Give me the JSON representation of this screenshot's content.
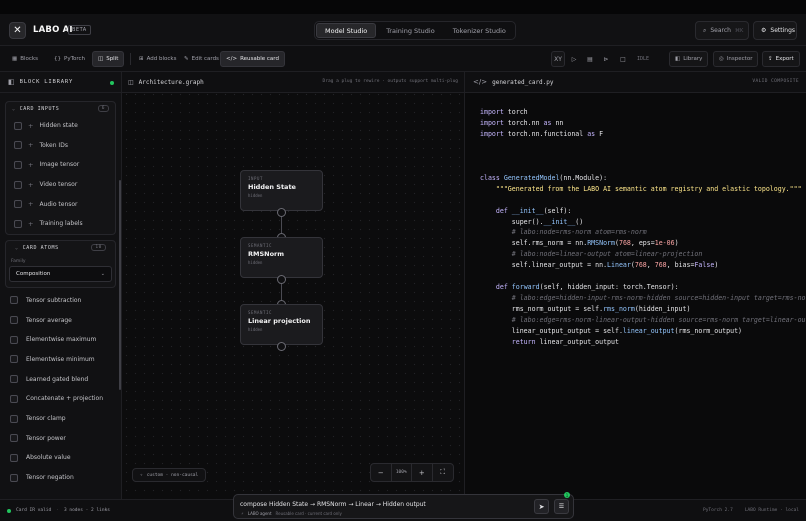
{
  "app": {
    "brand": "LABO AI",
    "badge": "BETA",
    "studio_tabs": [
      {
        "label": "Model Studio",
        "active": true
      },
      {
        "label": "Training Studio",
        "active": false
      },
      {
        "label": "Tokenizer Studio",
        "active": false
      }
    ],
    "search_label": "Search",
    "search_shortcut": "⌘K",
    "settings_label": "Settings"
  },
  "toolbar": {
    "blocks": "Blocks",
    "pytorch": "PyTorch",
    "split": "Split",
    "add_blocks": "Add blocks",
    "edit_cards": "Edit cards",
    "reusable_card": "Reusable card",
    "xy": "XY",
    "idle": "IDLE",
    "library": "Library",
    "inspector": "Inspector",
    "export": "Export"
  },
  "block_library": {
    "title": "BLOCK LIBRARY",
    "card_inputs": {
      "title": "CARD INPUTS",
      "count": "6",
      "items": [
        "Hidden state",
        "Token IDs",
        "Image tensor",
        "Video tensor",
        "Audio tensor",
        "Training labels"
      ]
    },
    "card_atoms": {
      "title": "CARD ATOMS",
      "count": "10",
      "family_label": "Family",
      "family_value": "Composition",
      "items": [
        "Tensor subtraction",
        "Tensor average",
        "Elementwise maximum",
        "Elementwise minimum",
        "Learned gated blend",
        "Concatenate + projection",
        "Tensor clamp",
        "Tensor power",
        "Absolute value",
        "Tensor negation"
      ]
    }
  },
  "graph": {
    "title": "Architecture.graph",
    "hint": "Drag a plug to rewire · outputs support multi-plug",
    "nodes": [
      {
        "kind": "INPUT",
        "title": "Hidden State",
        "sub": "hidden"
      },
      {
        "kind": "SEMANTIC",
        "title": "RMSNorm",
        "sub": "hidden"
      },
      {
        "kind": "SEMANTIC",
        "title": "Linear projection",
        "sub": "hidden"
      }
    ],
    "mode": "custom · non-causal",
    "zoom": "100%",
    "zoom_minus": "−",
    "zoom_plus": "+",
    "fit": "⛶"
  },
  "code": {
    "filename": "generated_card.py",
    "status": "VALID COMPOSITE"
  },
  "status": {
    "ir": "Card IR valid",
    "summary": "3 nodes · 2 links",
    "pytorch": "PyTorch 2.7",
    "runtime": "LABO Runtime · local"
  },
  "prompt": {
    "value": "compose Hidden State → RMSNorm → Linear → Hidden output",
    "agent_label": "LABO agent",
    "agent_context": "Reusable card · current card only",
    "badge": "1"
  },
  "colors": {
    "accent_green": "#22c55e",
    "keyword": "#c4b5fd",
    "function": "#93c5fd",
    "string": "#fde68a",
    "comment": "#71717a"
  }
}
